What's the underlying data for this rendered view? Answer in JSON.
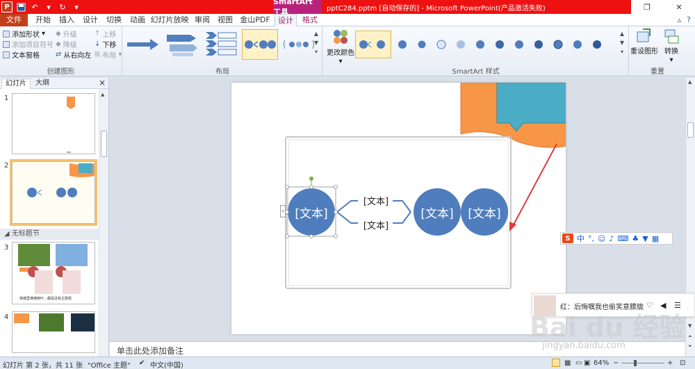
{
  "titlebar": {
    "context_tool_label": "SmartArt 工具",
    "doc_title": "pptC284.pptm [自动保存的] - Microsoft PowerPoint(产品激活失败)",
    "app_icon": "P"
  },
  "tabs": {
    "file": "文件",
    "items": [
      "开始",
      "插入",
      "设计",
      "切换",
      "动画",
      "幻灯片放映",
      "审阅",
      "视图",
      "金山PDF"
    ],
    "context_tabs": [
      "设计",
      "格式"
    ]
  },
  "ribbon": {
    "create_group": {
      "label": "创建图形",
      "add_shape": "添加形状",
      "add_bullet": "添加项目符号",
      "text_pane": "文本窗格",
      "promote": "升级",
      "demote": "降级",
      "right_to_left": "从右向左",
      "move_up": "上移",
      "move_down": "下移",
      "layout": "布局"
    },
    "layout_group": {
      "label": "布局"
    },
    "color_group": {
      "change_colors": "更改颜色"
    },
    "styles_group": {
      "label": "SmartArt 样式"
    },
    "reset_group": {
      "label": "重置",
      "reset_graphic": "重设图形",
      "convert": "转换"
    }
  },
  "left_pane": {
    "tab_slides": "幻灯片",
    "tab_outline": "大纲",
    "close_glyph": "×",
    "section_title": "无标题节",
    "slide_numbers": [
      "1",
      "2",
      "3",
      "4"
    ],
    "thumb3_caption": "荷塘里满满荷叶，都是没有主题呢"
  },
  "slide": {
    "node_text": "[文本]"
  },
  "notes": {
    "placeholder": "单击此处添加备注"
  },
  "statusbar": {
    "slide_info": "幻灯片 第 2 张，共 11 张",
    "theme": "\"Office 主题\"",
    "language": "中文(中国)",
    "zoom": "64%"
  },
  "ime_bar": {
    "logo": "S",
    "label": "中"
  },
  "music_popup": {
    "text": "红：后悔嘱我也偷笑意朦胧"
  },
  "watermark": {
    "text": "Bai du 经验",
    "url": "jingyan.baidu.com"
  },
  "colors": {
    "title_red": "#ee1111",
    "context_magenta": "#b7237c",
    "node_blue": "#4f7dbd",
    "banner_orange": "#f79646",
    "banner_teal": "#4bacc6",
    "arrow_red": "#e23a3a"
  }
}
